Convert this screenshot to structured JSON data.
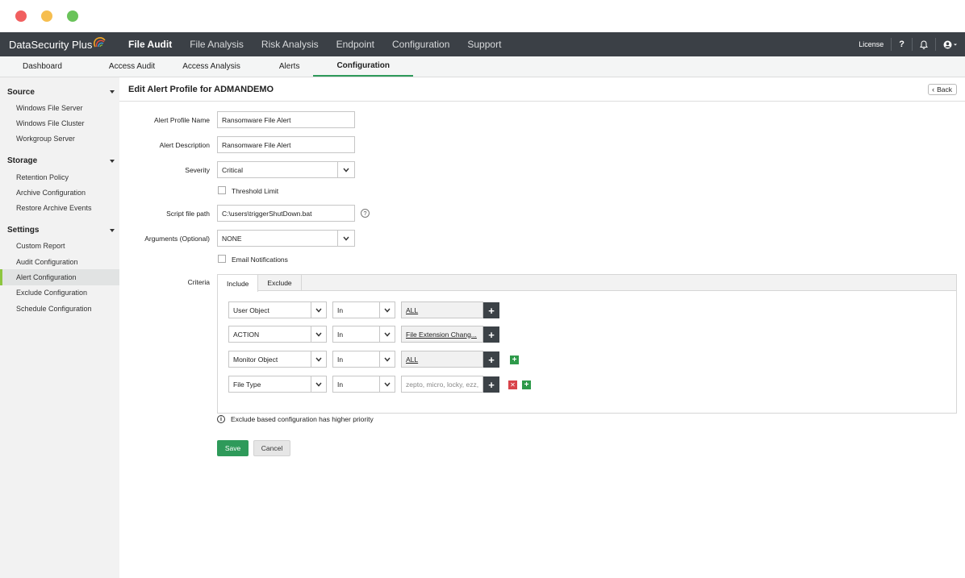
{
  "topnav": {
    "brand": "DataSecurity Plus",
    "menu": [
      "File Audit",
      "File Analysis",
      "Risk Analysis",
      "Endpoint",
      "Configuration",
      "Support"
    ],
    "license": "License",
    "help": "?"
  },
  "subnav": {
    "items": [
      "Dashboard",
      "Access Audit",
      "Access Analysis",
      "Alerts",
      "Configuration"
    ]
  },
  "sidebar": {
    "source": {
      "title": "Source",
      "items": [
        "Windows File Server",
        "Windows File Cluster",
        "Workgroup Server"
      ]
    },
    "storage": {
      "title": "Storage",
      "items": [
        "Retention Policy",
        "Archive Configuration",
        "Restore Archive Events"
      ]
    },
    "settings": {
      "title": "Settings",
      "items": [
        "Custom Report",
        "Audit Configuration",
        "Alert Configuration",
        "Exclude Configuration",
        "Schedule Configuration"
      ]
    }
  },
  "page": {
    "title": "Edit Alert Profile for ADMANDEMO",
    "back": "Back"
  },
  "form": {
    "profile_name_label": "Alert Profile Name",
    "profile_name_value": "Ransomware File Alert",
    "description_label": "Alert Description",
    "description_value": "Ransomware File Alert",
    "severity_label": "Severity",
    "severity_value": "Critical",
    "threshold_label": "Threshold Limit",
    "script_label": "Script file path",
    "script_value": "C:\\users\\triggerShutDown.bat",
    "arguments_label": "Arguments (Optional)",
    "arguments_value": "NONE",
    "email_label": "Email Notifications",
    "criteria_label": "Criteria"
  },
  "criteria": {
    "tabs": [
      "Include",
      "Exclude"
    ],
    "rows": [
      {
        "field": "User Object",
        "op": "In",
        "value": "ALL"
      },
      {
        "field": "ACTION",
        "op": "In",
        "value": "File Extension Chang..."
      },
      {
        "field": "Monitor Object",
        "op": "In",
        "value": "ALL"
      },
      {
        "field": "File Type",
        "op": "In",
        "value": "zepto, micro, locky, ezz,"
      }
    ],
    "note": "Exclude based configuration has higher priority"
  },
  "buttons": {
    "save": "Save",
    "cancel": "Cancel"
  },
  "colors": {
    "accent": "#2e9a5a",
    "nav_bg": "#3b4046",
    "sidebar_active": "#8dc63f",
    "remove": "#d9434a"
  }
}
